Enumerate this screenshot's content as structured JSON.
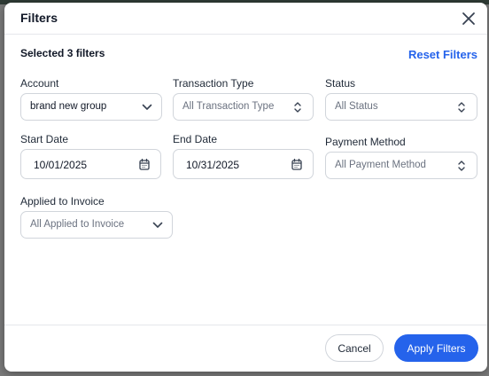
{
  "modal": {
    "title": "Filters",
    "selected_text": "Selected 3 filters",
    "reset_label": "Reset Filters"
  },
  "filters": {
    "account": {
      "label": "Account",
      "value": "brand new group"
    },
    "transaction_type": {
      "label": "Transaction Type",
      "placeholder": "All Transaction Type"
    },
    "status": {
      "label": "Status",
      "placeholder": "All Status"
    },
    "start_date": {
      "label": "Start Date",
      "value": "10/01/2025"
    },
    "end_date": {
      "label": "End Date",
      "value": "10/31/2025"
    },
    "payment_method": {
      "label": "Payment Method",
      "placeholder": "All Payment Method"
    },
    "applied_to_invoice": {
      "label": "Applied to Invoice",
      "placeholder": "All Applied to Invoice"
    }
  },
  "footer": {
    "cancel_label": "Cancel",
    "apply_label": "Apply Filters"
  },
  "colors": {
    "accent": "#2563eb",
    "border": "#d1d5db",
    "text": "#111827",
    "placeholder": "#6b7280"
  },
  "icons": [
    "close-icon",
    "chevron-down-icon",
    "chevron-up-down-icon",
    "calendar-icon"
  ]
}
